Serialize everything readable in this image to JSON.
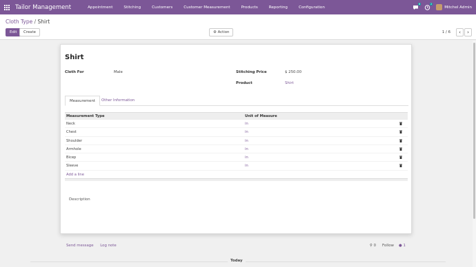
{
  "app": {
    "title": "Tailor Management"
  },
  "menu": [
    "Appointment",
    "Stitching",
    "Customers",
    "Customer Measurement",
    "Products",
    "Reporting",
    "Configuration"
  ],
  "user": {
    "name": "Mitchel Admin",
    "chat_badge": "6",
    "activity_badge": "2"
  },
  "breadcrumb": {
    "parent": "Cloth Type",
    "separator": "/",
    "current": "Shirt"
  },
  "toolbar": {
    "edit_label": "Edit",
    "create_label": "Create",
    "action_label": "Action"
  },
  "pager": {
    "value": "1 / 6"
  },
  "record": {
    "title": "Shirt",
    "cloth_for_label": "Cloth For",
    "cloth_for_value": "Male",
    "stitching_price_label": "Stitching Price",
    "stitching_price_value": "$ 250.00",
    "product_label": "Product",
    "product_value": "Shirt"
  },
  "tabs": {
    "measurement": "Measurement",
    "other": "Other Information"
  },
  "table": {
    "col_type": "Measurement Type",
    "col_unit": "Unit of Measure",
    "rows": [
      {
        "type": "Neck",
        "unit": "in"
      },
      {
        "type": "Chest",
        "unit": "in"
      },
      {
        "type": "Shoulder",
        "unit": "in"
      },
      {
        "type": "Armhole",
        "unit": "in"
      },
      {
        "type": "Bicep",
        "unit": "in"
      },
      {
        "type": "Sleeve",
        "unit": "in"
      }
    ],
    "add_line": "Add a line"
  },
  "description_label": "Description",
  "chatter": {
    "send_message": "Send message",
    "log_note": "Log note",
    "attachments": "0",
    "follow": "Follow",
    "followers": "1"
  },
  "today_label": "Today",
  "colors": {
    "brand": "#7c5797",
    "accent": "#00a09d"
  }
}
